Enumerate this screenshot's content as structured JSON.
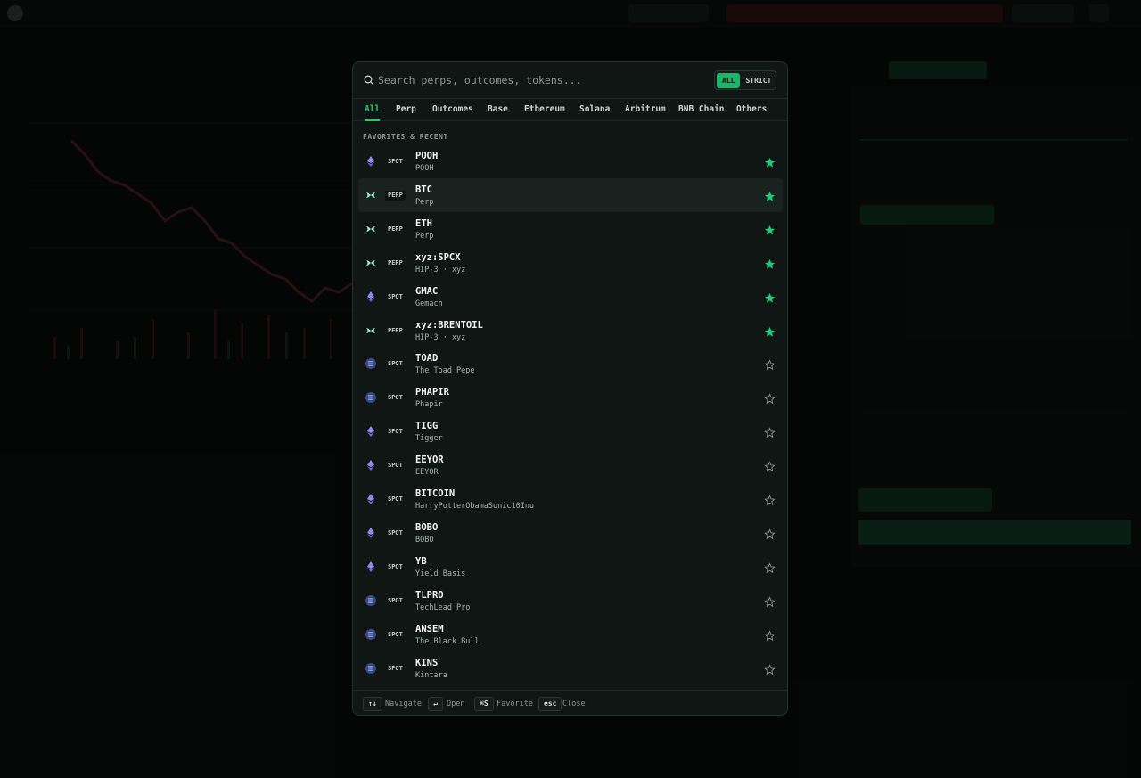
{
  "search": {
    "placeholder": "Search perps, outcomes, tokens..."
  },
  "mode_toggle": {
    "all_label": "ALL",
    "strict_label": "STRICT",
    "selected": "ALL"
  },
  "tabs": [
    {
      "label": "All",
      "active": true
    },
    {
      "label": "Perp"
    },
    {
      "label": "Outcomes"
    },
    {
      "label": "Base"
    },
    {
      "label": "Ethereum"
    },
    {
      "label": "Solana"
    },
    {
      "label": "Arbitrum"
    },
    {
      "label": "BNB Chain"
    },
    {
      "label": "Others"
    }
  ],
  "section_label": "FAVORITES & RECENT",
  "rows": [
    {
      "type": "SPOT",
      "symbol": "POOH",
      "name": "POOH",
      "icon": "ethereum-icon",
      "favorite": true
    },
    {
      "type": "PERP",
      "symbol": "BTC",
      "name": "Perp",
      "icon": "hyperliquid-icon",
      "favorite": true,
      "hover": true
    },
    {
      "type": "PERP",
      "symbol": "ETH",
      "name": "Perp",
      "icon": "hyperliquid-icon",
      "favorite": true
    },
    {
      "type": "PERP",
      "symbol": "xyz:SPCX",
      "name": "HIP-3 · xyz",
      "icon": "hyperliquid-icon",
      "favorite": true
    },
    {
      "type": "SPOT",
      "symbol": "GMAC",
      "name": "Gemach",
      "icon": "ethereum-icon",
      "favorite": true
    },
    {
      "type": "PERP",
      "symbol": "xyz:BRENTOIL",
      "name": "HIP-3 · xyz",
      "icon": "hyperliquid-icon",
      "favorite": true
    },
    {
      "type": "SPOT",
      "symbol": "TOAD",
      "name": "The Toad Pepe",
      "icon": "solana-icon",
      "favorite": false
    },
    {
      "type": "SPOT",
      "symbol": "PHAPIR",
      "name": "Phapir",
      "icon": "solana-icon",
      "favorite": false
    },
    {
      "type": "SPOT",
      "symbol": "TIGG",
      "name": "Tigger",
      "icon": "ethereum-icon",
      "favorite": false
    },
    {
      "type": "SPOT",
      "symbol": "EEYOR",
      "name": "EEYOR",
      "icon": "ethereum-icon",
      "favorite": false
    },
    {
      "type": "SPOT",
      "symbol": "BITCOIN",
      "name": "HarryPotterObamaSonic10Inu",
      "icon": "ethereum-icon",
      "favorite": false
    },
    {
      "type": "SPOT",
      "symbol": "BOBO",
      "name": "BOBO",
      "icon": "ethereum-icon",
      "favorite": false
    },
    {
      "type": "SPOT",
      "symbol": "YB",
      "name": "Yield Basis",
      "icon": "ethereum-icon",
      "favorite": false
    },
    {
      "type": "SPOT",
      "symbol": "TLPRO",
      "name": "TechLead Pro",
      "icon": "solana-icon",
      "favorite": false
    },
    {
      "type": "SPOT",
      "symbol": "ANSEM",
      "name": "The Black Bull",
      "icon": "solana-icon",
      "favorite": false
    },
    {
      "type": "SPOT",
      "symbol": "KINS",
      "name": "Kintara",
      "icon": "solana-icon",
      "favorite": false
    }
  ],
  "footer": [
    {
      "key": "↑↓",
      "label": "Navigate"
    },
    {
      "key": "↵",
      "label": "Open"
    },
    {
      "key": "⌘S",
      "label": "Favorite"
    },
    {
      "key": "esc",
      "label": "Close"
    }
  ],
  "colors": {
    "accent": "#26c97a",
    "star_active": "#26c97a",
    "star_inactive": "#8a958f"
  }
}
